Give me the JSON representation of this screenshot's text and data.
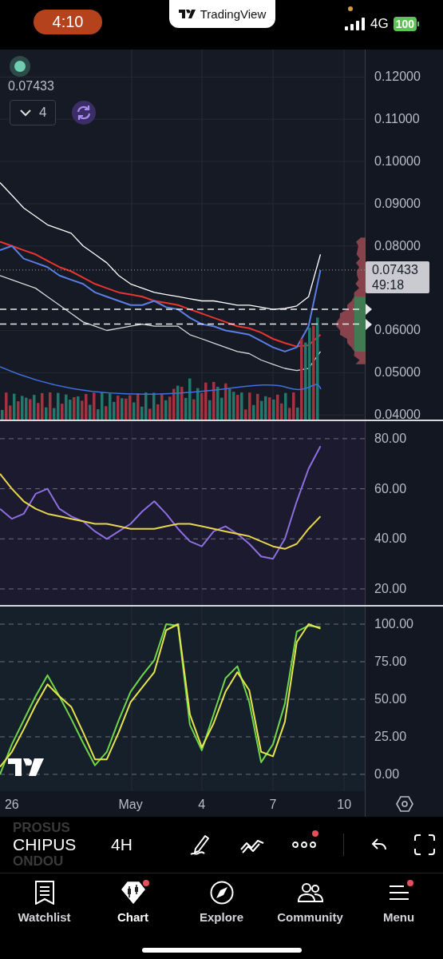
{
  "status_bar": {
    "time": "4:10",
    "app_badge": "TradingView",
    "network": "4G",
    "battery": "100"
  },
  "chart_overlay": {
    "price": "0.07433",
    "count": "4"
  },
  "panels": [
    {
      "kind": "price",
      "last_price": {
        "price": "0.07433",
        "countdown": "49:18"
      },
      "chart_data": {
        "type": "line",
        "categories": [
          null,
          null,
          null,
          null,
          null,
          null,
          null,
          null,
          null,
          null,
          null,
          null,
          null,
          null,
          null,
          null,
          null,
          null,
          null,
          null,
          null,
          null,
          null,
          null,
          null,
          null,
          null,
          null
        ],
        "ylim": [
          0.0389,
          0.1265
        ],
        "yticks": [
          {
            "value": 0.12,
            "label": "0.12000"
          },
          {
            "value": 0.11,
            "label": "0.11000"
          },
          {
            "value": 0.1,
            "label": "0.10000"
          },
          {
            "value": 0.09,
            "label": "0.09000"
          },
          {
            "value": 0.08,
            "label": "0.08000"
          },
          {
            "value": 0.06,
            "label": "0.06000"
          },
          {
            "value": 0.05,
            "label": "0.05000"
          },
          {
            "value": 0.04,
            "label": "0.04000"
          }
        ],
        "grid": true,
        "series": [
          {
            "color": "#ffffff",
            "values": [
              0.095,
              0.092,
              0.089,
              0.087,
              0.085,
              0.084,
              0.083,
              0.08,
              0.078,
              0.076,
              0.073,
              0.071,
              0.07,
              0.069,
              0.0685,
              0.068,
              0.0675,
              0.067,
              0.067,
              0.0665,
              0.066,
              0.066,
              0.0655,
              0.065,
              0.0652,
              0.0658,
              0.068,
              0.078
            ]
          },
          {
            "color": "#d8d8d8",
            "values": [
              0.073,
              0.072,
              0.071,
              0.07,
              0.068,
              0.066,
              0.064,
              0.062,
              0.061,
              0.06,
              0.0605,
              0.061,
              0.0615,
              0.061,
              0.061,
              0.061,
              0.059,
              0.058,
              0.057,
              0.056,
              0.055,
              0.0545,
              0.053,
              0.052,
              0.051,
              0.0505,
              0.051,
              0.055
            ]
          },
          {
            "color": "#e8352f",
            "values": [
              0.081,
              0.08,
              0.079,
              0.078,
              0.0765,
              0.075,
              0.074,
              0.0725,
              0.071,
              0.07,
              0.069,
              0.0685,
              0.068,
              0.067,
              0.0665,
              0.066,
              0.065,
              0.064,
              0.063,
              0.062,
              0.061,
              0.0605,
              0.0595,
              0.058,
              0.057,
              0.0562,
              0.0565,
              0.059
            ]
          },
          {
            "color": "#5b7ee5",
            "values": [
              0.079,
              0.08,
              0.077,
              0.076,
              0.075,
              0.073,
              0.072,
              0.071,
              0.069,
              0.068,
              0.067,
              0.066,
              0.066,
              0.067,
              0.0655,
              0.065,
              0.063,
              0.0615,
              0.061,
              0.06,
              0.0595,
              0.059,
              0.0575,
              0.056,
              0.055,
              0.056,
              0.061,
              0.0743
            ]
          }
        ]
      }
    },
    {
      "kind": "rsi",
      "chart_data": {
        "type": "line",
        "categories": [
          null,
          null,
          null,
          null,
          null,
          null,
          null,
          null,
          null,
          null,
          null,
          null,
          null,
          null,
          null,
          null,
          null,
          null,
          null,
          null,
          null,
          null,
          null,
          null,
          null,
          null,
          null,
          null
        ],
        "ylim": [
          13.6,
          87
        ],
        "grid": true,
        "yticks": [
          {
            "value": 80,
            "label": "80.00"
          },
          {
            "value": 60,
            "label": "60.00"
          },
          {
            "value": 40,
            "label": "40.00"
          },
          {
            "value": 20,
            "label": "20.00"
          }
        ],
        "series": [
          {
            "color": "#8e6ee0",
            "values": [
              52,
              48,
              50,
              58,
              60,
              52,
              49,
              47,
              43,
              40,
              43,
              46,
              51,
              55,
              50,
              44,
              39,
              37,
              43,
              45,
              42,
              38,
              33,
              32,
              40,
              55,
              68,
              77
            ]
          },
          {
            "color": "#e8d44d",
            "values": [
              66,
              60,
              55,
              52,
              50,
              49,
              48,
              47,
              46,
              46,
              45,
              44,
              44,
              44,
              45,
              46,
              46,
              45,
              44,
              43,
              42,
              41,
              39,
              37,
              36,
              38,
              44,
              49
            ]
          }
        ]
      }
    },
    {
      "kind": "stoch",
      "chart_data": {
        "type": "line",
        "categories": [
          null,
          "26",
          null,
          null,
          null,
          null,
          null,
          null,
          null,
          null,
          null,
          "May",
          null,
          null,
          null,
          null,
          null,
          "4",
          null,
          null,
          null,
          null,
          null,
          "7",
          null,
          null,
          null,
          null,
          null,
          "10"
        ],
        "ylim": [
          -11.2,
          111.7
        ],
        "grid": true,
        "yticks": [
          {
            "value": 100,
            "label": "100.00"
          },
          {
            "value": 75,
            "label": "75.00"
          },
          {
            "value": 50,
            "label": "50.00"
          },
          {
            "value": 25,
            "label": "25.00"
          },
          {
            "value": 0,
            "label": "0.00"
          }
        ],
        "series": [
          {
            "color": "#6fd64a",
            "values": [
              0,
              20,
              36,
              52,
              66,
              52,
              37,
              21,
              6,
              15,
              36,
              55,
              66,
              76,
              100,
              99,
              33,
              16,
              40,
              64,
              72,
              48,
              8,
              20,
              47,
              95,
              99,
              98,
              null,
              null
            ]
          },
          {
            "color": "#e8e44d",
            "values": [
              5,
              15,
              30,
              46,
              60,
              52,
              45,
              28,
              10,
              10,
              28,
              48,
              58,
              68,
              96,
              100,
              40,
              18,
              34,
              55,
              68,
              56,
              15,
              12,
              35,
              88,
              100,
              97,
              null,
              null
            ]
          }
        ]
      }
    }
  ],
  "toolbar": {
    "symbols": [
      {
        "label": "PROSUS",
        "selected": false
      },
      {
        "label": "CHIPUS",
        "selected": true
      },
      {
        "label": "ONDOU",
        "selected": false
      }
    ],
    "interval": "4H",
    "more_badge": true
  },
  "tabs": [
    {
      "label": "Watchlist",
      "kind": "watchlist",
      "selected": false,
      "badge": false
    },
    {
      "label": "Chart",
      "kind": "chart",
      "selected": true,
      "badge": true
    },
    {
      "label": "Explore",
      "kind": "explore",
      "selected": false,
      "badge": false
    },
    {
      "label": "Community",
      "kind": "community",
      "selected": false,
      "badge": false
    },
    {
      "label": "Menu",
      "kind": "menu",
      "selected": false,
      "badge": true
    }
  ]
}
